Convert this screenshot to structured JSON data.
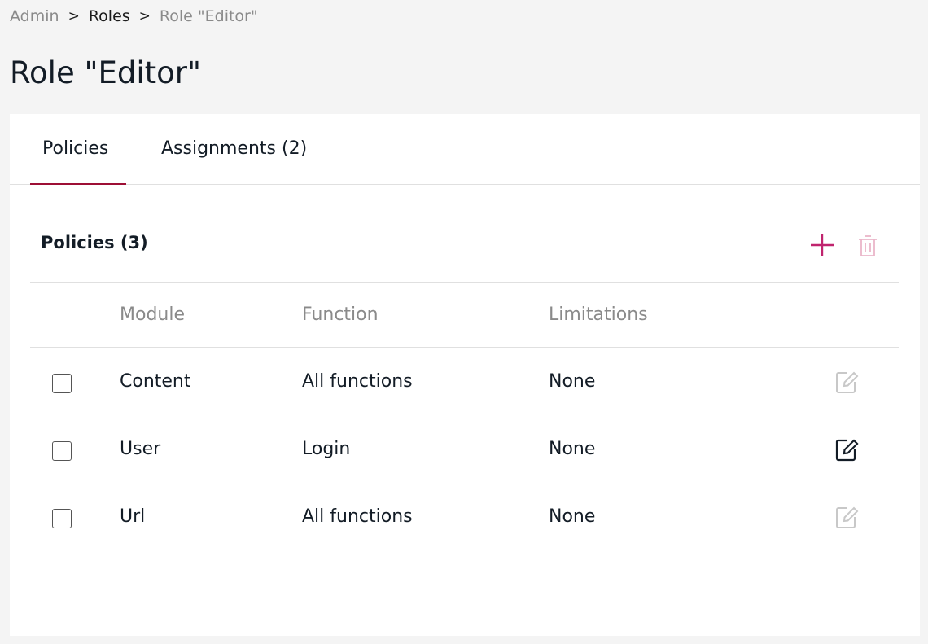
{
  "breadcrumb": {
    "items": [
      "Admin",
      "Roles",
      "Role \"Editor\""
    ],
    "separator": ">"
  },
  "page_title": "Role \"Editor\"",
  "tabs": [
    {
      "label": "Policies",
      "active": true
    },
    {
      "label": "Assignments (2)",
      "active": false
    }
  ],
  "policies": {
    "title": "Policies (3)",
    "add_icon": "plus-icon",
    "delete_icon": "trash-icon",
    "columns": [
      "Module",
      "Function",
      "Limitations"
    ],
    "rows": [
      {
        "module": "Content",
        "function": "All functions",
        "limitations": "None",
        "edit_enabled": false
      },
      {
        "module": "User",
        "function": "Login",
        "limitations": "None",
        "edit_enabled": true
      },
      {
        "module": "Url",
        "function": "All functions",
        "limitations": "None",
        "edit_enabled": false
      }
    ]
  },
  "colors": {
    "accent": "#9d0f35",
    "add_icon": "#c0246e",
    "delete_icon_disabled": "#eab6c9",
    "edit_disabled": "#c8c8c8",
    "edit_enabled": "#131c26"
  }
}
